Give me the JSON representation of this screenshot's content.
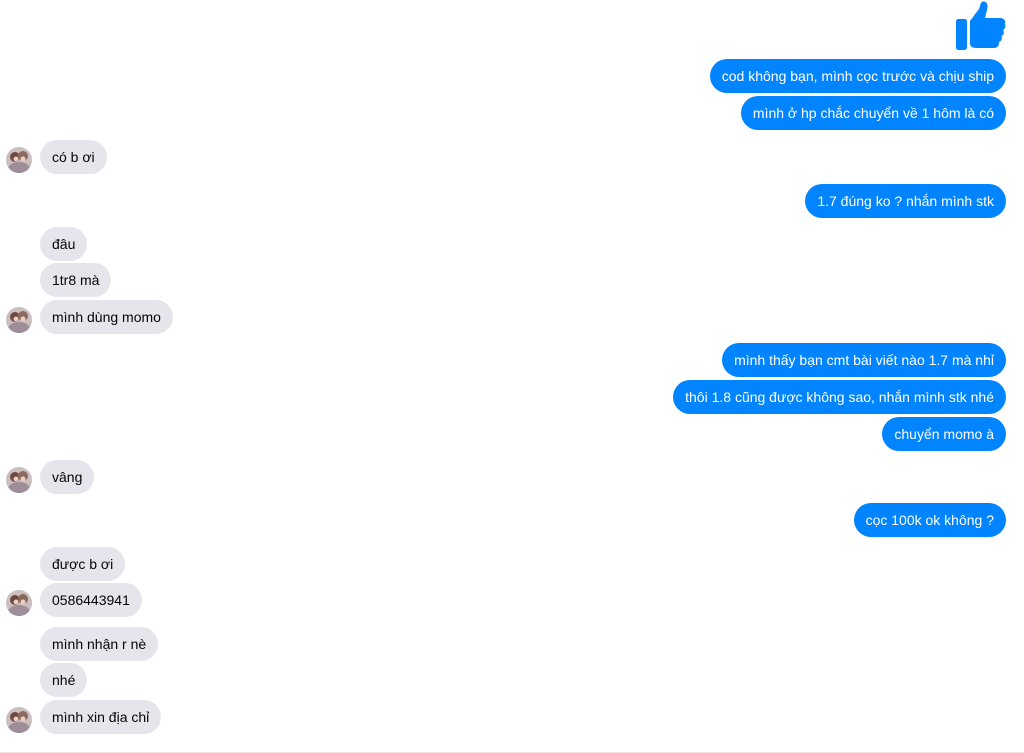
{
  "icons": {
    "like": "thumbs-up-icon",
    "avatar": "contact-avatar"
  },
  "colors": {
    "sent_bubble": "#0084ff",
    "received_bubble": "#e4e6eb"
  },
  "messages": {
    "m1": "cod không bạn, mình cọc trước và chịu ship",
    "m2": "mình ở hp chắc chuyển về 1 hôm là có",
    "m3": "có b ơi",
    "m4": "1.7 đúng ko ? nhắn mình stk",
    "m5": "đâu",
    "m6": "1tr8 mà",
    "m7": "mình dùng momo",
    "m8": "mình thấy bạn cmt bài viết nào 1.7 mà nhỉ",
    "m9": "thôi 1.8 cũng được không sao, nhắn mình stk nhé",
    "m10": "chuyển momo à",
    "m11": "vâng",
    "m12": "cọc 100k ok không ?",
    "m13": "được b ơi",
    "m14": "0586443941",
    "m15": "mình nhận r nè",
    "m16": "nhé",
    "m17": "mình xin địa chỉ"
  }
}
